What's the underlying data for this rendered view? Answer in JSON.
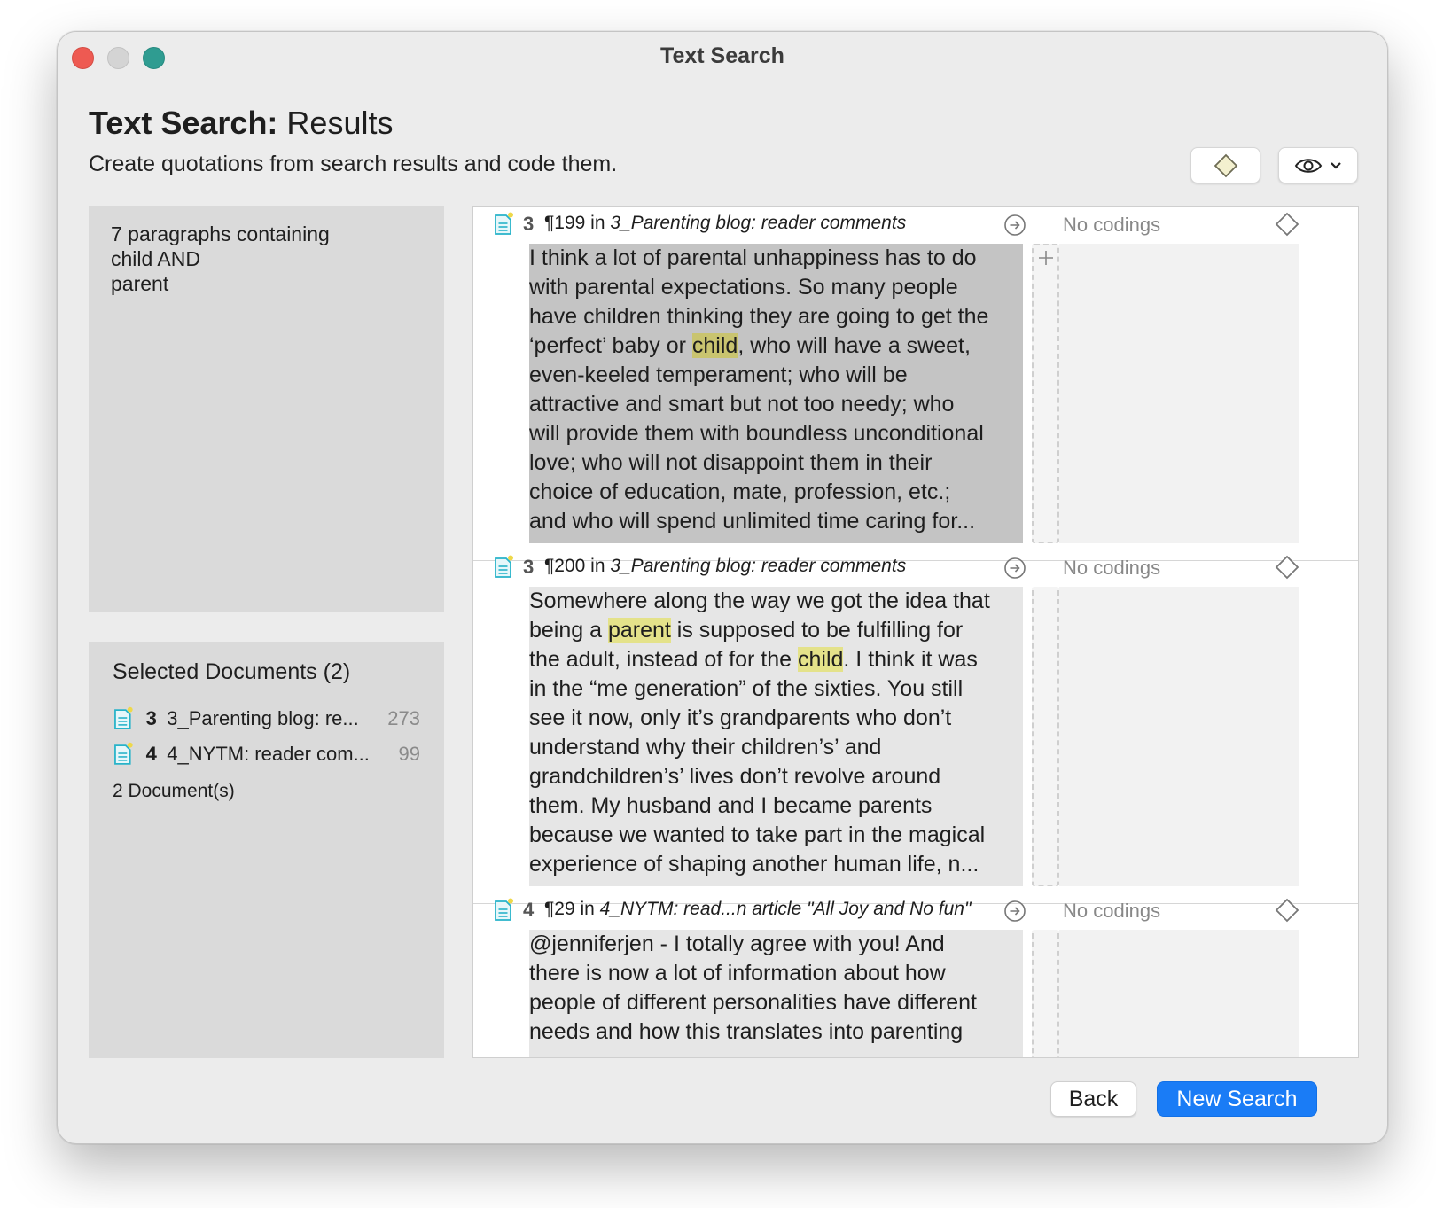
{
  "window": {
    "title": "Text Search"
  },
  "header": {
    "title_bold": "Text Search:",
    "title_rest": " Results",
    "subtitle": "Create quotations from search results and code them."
  },
  "query": {
    "lines": [
      "7 paragraphs containing",
      "child AND",
      "parent"
    ]
  },
  "selected_documents": {
    "title": "Selected Documents (2)",
    "items": [
      {
        "num": "3",
        "name": "3_Parenting blog: re...",
        "count": "273"
      },
      {
        "num": "4",
        "name": "4_NYTM: reader com...",
        "count": "99"
      }
    ],
    "footer": "2 Document(s)"
  },
  "results": [
    {
      "doc_num": "3",
      "para": "¶199 in ",
      "doc_name": "3_Parenting blog: reader comments",
      "codings": "No codings",
      "lines": [
        "I think a lot of parental unhappiness has to do",
        "with parental expectations. So many people",
        "have children thinking they are going to get the",
        "‘perfect’ baby or |child|, who will have a sweet,",
        "even-keeled temperament; who will be",
        "attractive and smart but not too needy; who",
        "will provide them with boundless unconditional",
        "love; who will not disappoint them in their",
        "choice of education, mate, profession, etc.;",
        "and who will spend unlimited time caring for..."
      ]
    },
    {
      "doc_num": "3",
      "para": "¶200 in ",
      "doc_name": "3_Parenting blog: reader comments",
      "codings": "No codings",
      "lines": [
        "Somewhere along the way we got the idea that",
        "being a |parent| is supposed to be fulfilling for",
        "the adult, instead of for the |child|. I think it was",
        "in the “me generation” of the sixties. You still",
        "see it now, only it’s grandparents who don’t",
        "understand why their children’s’ and",
        "grandchildren’s’ lives don’t revolve around",
        "them. My husband and I became parents",
        "because we wanted to take part in the magical",
        "experience of shaping another human life, n..."
      ]
    },
    {
      "doc_num": "4",
      "para": "¶29 in ",
      "doc_name": "4_NYTM: read...n article \"All Joy and No fun\"",
      "codings": "No codings",
      "lines": [
        "@jenniferjen - I totally agree with you! And",
        "there is now a lot of information about how",
        "people of different personalities have different",
        "needs and how this translates into parenting"
      ]
    }
  ],
  "buttons": {
    "back": "Back",
    "new_search": "New Search"
  },
  "colors": {
    "accent": "#1a7cf6",
    "highlight": "#e4e28a",
    "doc_icon": "#27b3c9",
    "close": "#ee5a52",
    "zoom": "#2f9c91"
  },
  "icons": {
    "doc": "document-icon",
    "goto": "arrow-circle-right-icon",
    "code": "diamond-icon",
    "view": "eye-icon",
    "add": "plus-icon"
  }
}
